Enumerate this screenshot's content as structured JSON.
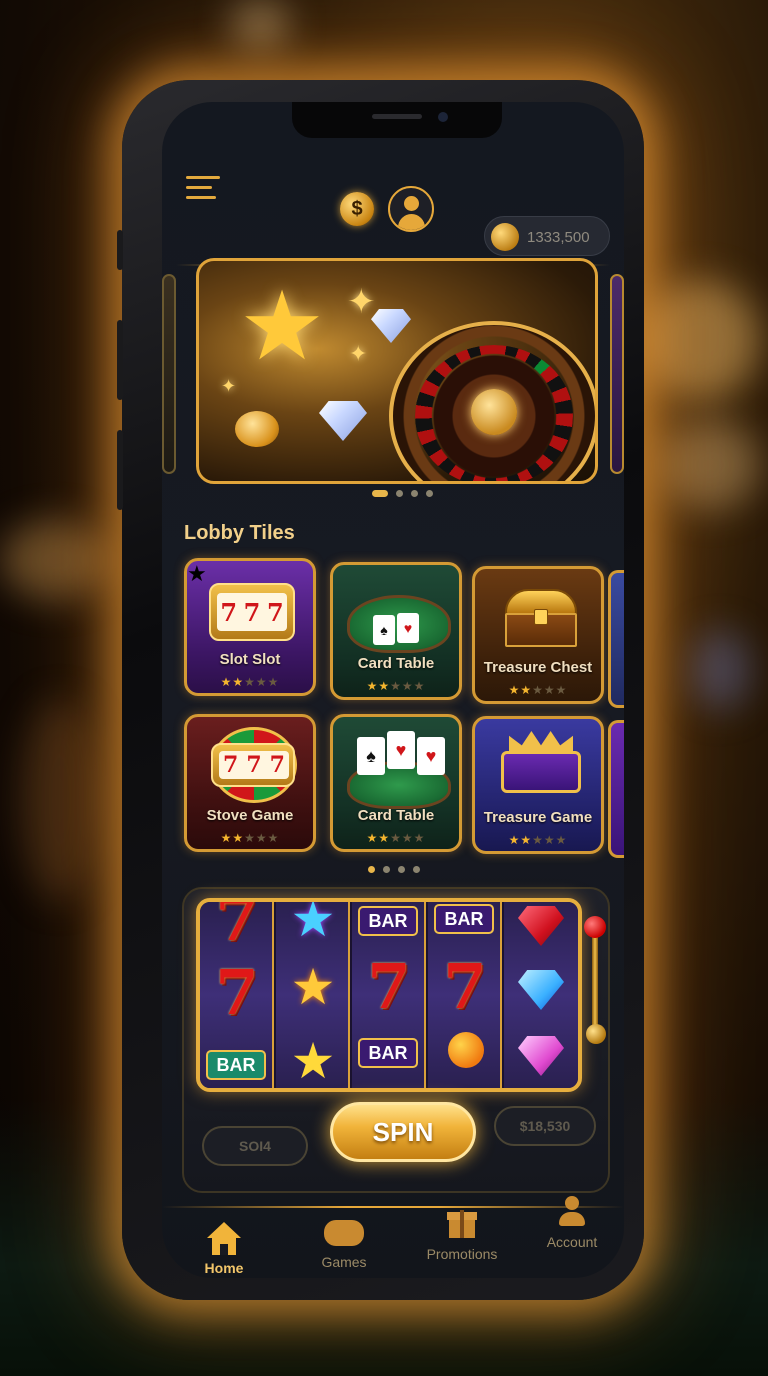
{
  "header": {
    "coin_symbol": "$",
    "balance": "1333,500"
  },
  "lobby": {
    "title": "Lobby Tiles",
    "tiles": [
      {
        "name": "Slot Slot",
        "rating": 2
      },
      {
        "name": "Card Table",
        "rating": 2
      },
      {
        "name": "Treasure Chest",
        "rating": 2
      },
      {
        "name": "Stove Game",
        "rating": 2
      },
      {
        "name": "Card Table",
        "rating": 2
      },
      {
        "name": "Treasure Game",
        "rating": 2
      }
    ]
  },
  "slot_machine": {
    "reels": [
      [
        "7",
        "7",
        "BAR"
      ],
      [
        "star",
        "star",
        "star"
      ],
      [
        "BAR",
        "7",
        "BAR"
      ],
      [
        "BAR",
        "7",
        "orange"
      ],
      [
        "gem-red",
        "gem-blue",
        "gem-pink"
      ]
    ],
    "left_value": "SOI4",
    "spin_label": "SPIN",
    "right_value": "$18,530"
  },
  "nav": {
    "items": [
      {
        "label": "Home",
        "icon": "home-icon",
        "active": true
      },
      {
        "label": "Games",
        "icon": "gamepad-icon",
        "active": false
      },
      {
        "label": "Promotions",
        "icon": "gift-icon",
        "active": false
      },
      {
        "label": "Account",
        "icon": "account-icon",
        "active": false
      }
    ]
  },
  "colors": {
    "accent_gold": "#e6a83a",
    "background": "#171a22"
  }
}
